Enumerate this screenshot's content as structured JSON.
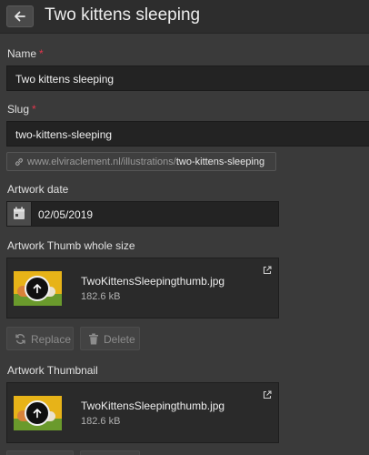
{
  "header": {
    "title": "Two kittens sleeping",
    "back_icon": "arrow-left-icon"
  },
  "name_field": {
    "label": "Name",
    "required_mark": "*",
    "value": "Two kittens sleeping"
  },
  "slug_field": {
    "label": "Slug",
    "required_mark": "*",
    "value": "two-kittens-sleeping"
  },
  "url": {
    "prefix": "www.elviraclement.nl/illustrations/",
    "slug": "two-kittens-sleeping",
    "icon": "link-icon"
  },
  "artwork_date": {
    "label": "Artwork date",
    "value": "02/05/2019",
    "icon": "calendar-icon"
  },
  "thumb_whole": {
    "label": "Artwork Thumb whole size",
    "file_name": "TwoKittensSleepingthumb.jpg",
    "file_size": "182.6 kB",
    "replace_label": "Replace",
    "delete_label": "Delete"
  },
  "thumbnail": {
    "label": "Artwork Thumbnail",
    "file_name": "TwoKittensSleepingthumb.jpg",
    "file_size": "182.6 kB"
  },
  "colors": {
    "background": "#3a3a3a",
    "header": "#2d2d2d",
    "required": "#e2374d",
    "field": "#232323"
  }
}
